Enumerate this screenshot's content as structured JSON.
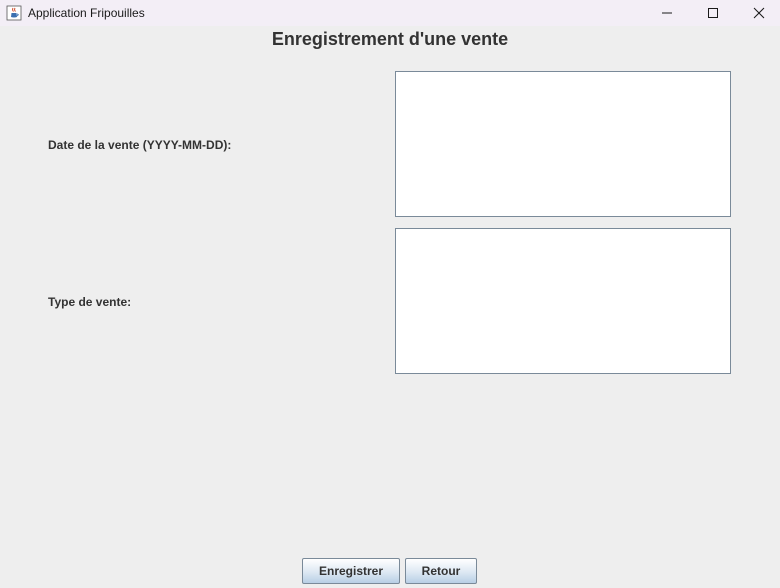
{
  "window": {
    "title": "Application Fripouilles",
    "icons": {
      "app": "java-cup-icon",
      "minimize": "minimize-icon",
      "maximize": "maximize-icon",
      "close": "close-icon"
    }
  },
  "form": {
    "title": "Enregistrement d'une vente",
    "fields": [
      {
        "label": "Date de la vente (YYYY-MM-DD):",
        "value": ""
      },
      {
        "label": "Type de vente:",
        "value": ""
      }
    ]
  },
  "buttons": {
    "save_label": "Enregistrer",
    "back_label": "Retour"
  },
  "colors": {
    "background": "#eeeeee",
    "titlebar": "#f3eef6",
    "text": "#333333",
    "button_gradient_bottom": "#b8cfe5"
  }
}
